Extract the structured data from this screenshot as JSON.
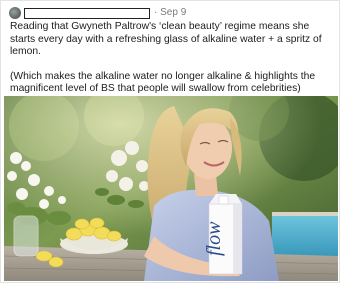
{
  "post": {
    "separator": "·",
    "date": "Sep 9",
    "paragraph1": "Reading that Gwyneth Paltrow's ‘clean beauty’ regime means she starts every day with a refreshing glass of alkaline water + a spritz of lemon.",
    "paragraph2": "(Which makes the alkaline water no longer alkaline & highlights the magnificent level of BS that people will swallow from celebrities)"
  },
  "photo": {
    "carton_brand": "flow"
  }
}
